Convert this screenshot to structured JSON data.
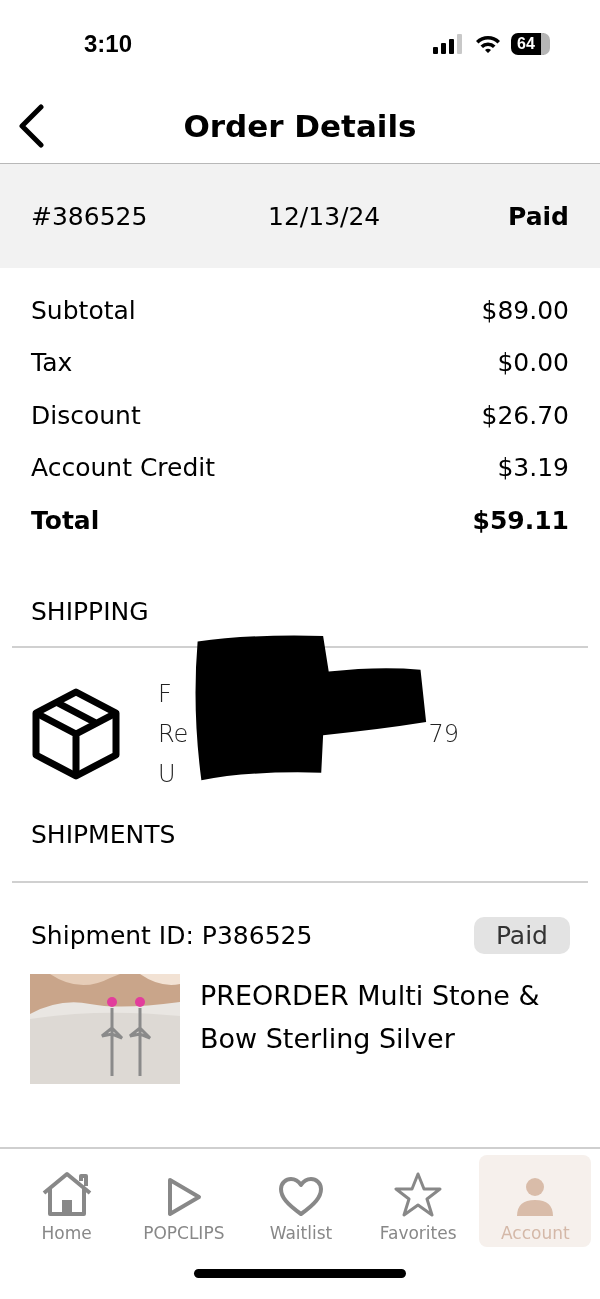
{
  "status_bar": {
    "time": "3:10",
    "battery": "64"
  },
  "header": {
    "title": "Order Details"
  },
  "order": {
    "number": "#386525",
    "date": "12/13/24",
    "status": "Paid"
  },
  "totals": [
    {
      "label": "Subtotal",
      "amount": "$89.00",
      "kind": "line"
    },
    {
      "label": "Tax",
      "amount": "$0.00",
      "kind": "line"
    },
    {
      "label": "Discount",
      "amount": "$26.70",
      "kind": "line"
    },
    {
      "label": "Account Credit",
      "amount": "$3.19",
      "kind": "line"
    },
    {
      "label": "Total",
      "amount": "$59.11",
      "kind": "total"
    }
  ],
  "shipping": {
    "heading": "SHIPPING",
    "address_lines": [
      [
        "F"
      ],
      [
        "Re",
        "79"
      ],
      [
        "U"
      ]
    ]
  },
  "shipments": {
    "heading": "SHIPMENTS",
    "items": [
      {
        "id_label": "Shipment ID: P386525",
        "status": "Paid",
        "product": {
          "name": "PREORDER Multi Stone & Bow Sterling Silver"
        }
      }
    ]
  },
  "tab_bar": [
    {
      "label": "Home",
      "kind": "home",
      "selected": false
    },
    {
      "label": "POPCLIPS",
      "kind": "play",
      "selected": false
    },
    {
      "label": "Waitlist",
      "kind": "heart",
      "selected": false
    },
    {
      "label": "Favorites",
      "kind": "star",
      "selected": false
    },
    {
      "label": "Account",
      "kind": "person",
      "selected": true
    }
  ]
}
